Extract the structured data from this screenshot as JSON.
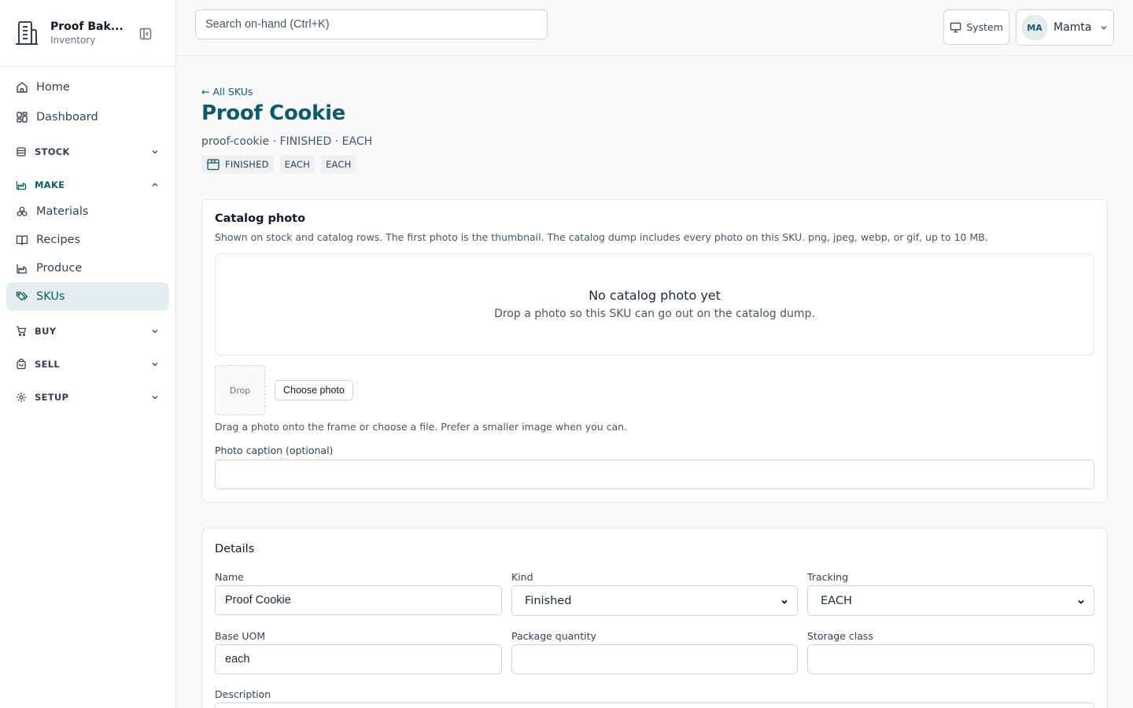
{
  "brand": {
    "name": "Proof Bak...",
    "subtitle": "Inventory"
  },
  "nav": {
    "home": "Home",
    "dashboard": "Dashboard",
    "stock": "STOCK",
    "make": "MAKE",
    "materials": "Materials",
    "recipes": "Recipes",
    "produce": "Produce",
    "skus": "SKUs",
    "buy": "BUY",
    "sell": "SELL",
    "setup": "SETUP"
  },
  "topbar": {
    "search_placeholder": "Search on-hand (Ctrl+K)",
    "system_label": "System",
    "user_initials": "MA",
    "user_name": "Mamta"
  },
  "page": {
    "back_link": "← All SKUs",
    "title": "Proof Cookie",
    "meta": "proof-cookie · FINISHED · EACH",
    "badges": [
      "FINISHED",
      "EACH",
      "EACH"
    ]
  },
  "photo_card": {
    "title": "Catalog photo",
    "description": "Shown on stock and catalog rows. The first photo is the thumbnail. The catalog dump includes every photo on this SKU. png, jpeg, webp, or gif, up to 10 MB.",
    "empty_title": "No catalog photo yet",
    "empty_subtitle": "Drop a photo so this SKU can go out on the catalog dump.",
    "drop_label": "Drop",
    "choose_button": "Choose photo",
    "hint": "Drag a photo onto the frame or choose a file. Prefer a smaller image when you can.",
    "caption_label": "Photo caption (optional)",
    "caption_value": ""
  },
  "details_card": {
    "title": "Details",
    "name_label": "Name",
    "name_value": "Proof Cookie",
    "kind_label": "Kind",
    "kind_value": "Finished",
    "tracking_label": "Tracking",
    "tracking_value": "EACH",
    "base_uom_label": "Base UOM",
    "base_uom_value": "each",
    "package_qty_label": "Package quantity",
    "package_qty_value": "",
    "storage_class_label": "Storage class",
    "storage_class_value": "",
    "description_label": "Description"
  },
  "colors": {
    "accent": "#0e5a66",
    "active_bg": "#e4eef0",
    "border": "#e5e7eb",
    "page_bg": "#f8f9fa"
  }
}
